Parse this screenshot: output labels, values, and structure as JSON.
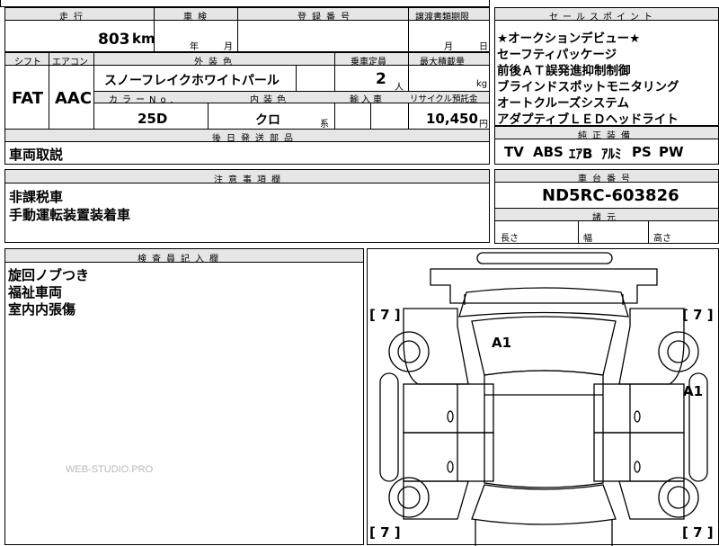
{
  "top": {
    "headers": {
      "mileage": "走行",
      "inspection": "車検",
      "registration": "登録番号",
      "transfer_deadline": "譲渡書類期限",
      "sales_point": "セールスポイント"
    },
    "mileage_value": "803",
    "mileage_unit": "km",
    "inspection_year": "年",
    "inspection_month": "月",
    "transfer_month": "月",
    "transfer_day": "日"
  },
  "spec": {
    "headers": {
      "shift": "シフト",
      "aircon": "エアコン",
      "exterior_color": "外装色",
      "capacity": "乗車定員",
      "max_load": "最大積載量",
      "color_no": "カラーNo.",
      "interior_color": "内装色",
      "import": "輸入車",
      "recycle": "リサイクル預託金"
    },
    "shift_value": "FAT",
    "aircon_value": "AAC",
    "exterior_color_value": "スノーフレイクホワイトパール",
    "capacity_value": "2",
    "capacity_unit": "人",
    "max_load_unit": "kg",
    "color_no_value": "25D",
    "interior_color_value": "クロ",
    "interior_color_suffix": "系",
    "recycle_value": "10,450",
    "recycle_unit": "円"
  },
  "sales_points": [
    "★オークションデビュー★",
    "セーフティパッケージ",
    "前後ＡＴ誤発進抑制制御",
    "ブラインドスポットモニタリング",
    "オートクルーズシステム",
    "アダプティブＬＥＤヘッドライト"
  ],
  "equipment": {
    "header": "純正装備",
    "items": [
      "TV",
      "ABS",
      "ｴｱB",
      "ｱﾙﾐ",
      "PS",
      "PW"
    ]
  },
  "later_parts": {
    "header": "後日発送部品",
    "value": "車両取説"
  },
  "notes": {
    "header": "注意事項欄",
    "lines": [
      "非課税車",
      "手動運転装置装着車"
    ]
  },
  "chassis": {
    "header": "車台番号",
    "value": "ND5RC-603826"
  },
  "dimensions": {
    "header": "諸元",
    "length": "長さ",
    "width": "幅",
    "height": "高さ"
  },
  "inspector": {
    "header": "検査員記入欄",
    "lines": [
      "旋回ノブつき",
      "福祉車両",
      "室内内張傷"
    ]
  },
  "watermark": "WEB-STUDIO.PRO",
  "diagram": {
    "marks": {
      "front_left": "[ 7 ]",
      "front_right": "[ 7 ]",
      "rear_left": "[ 7 ]",
      "rear_right": "[ 7 ]",
      "windshield": "A1",
      "right_side": "A1"
    }
  }
}
